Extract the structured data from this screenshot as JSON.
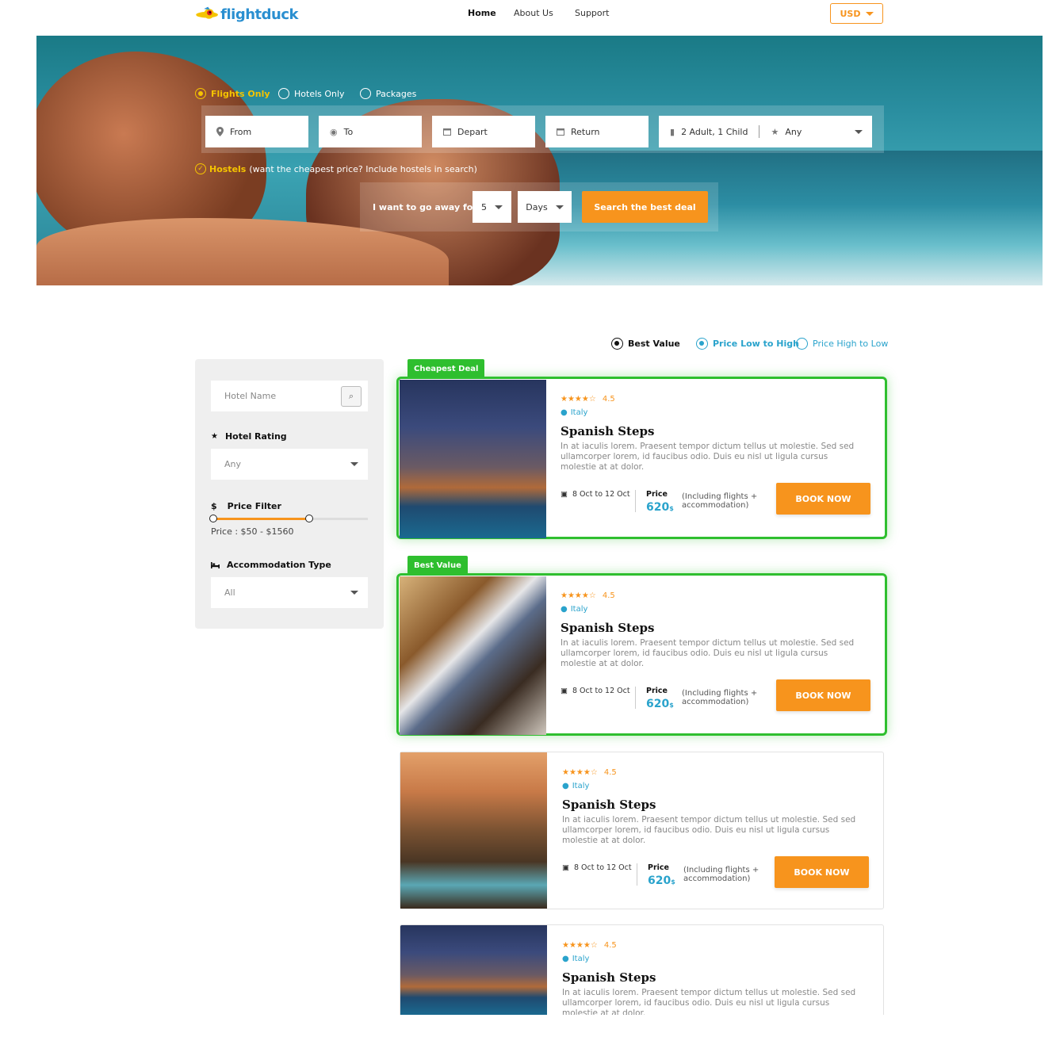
{
  "header": {
    "logo_text": "flightduck",
    "nav": [
      "Home",
      "About Us",
      "Support"
    ],
    "currency": "USD"
  },
  "search": {
    "trip_types": [
      "Flights Only",
      "Hotels Only",
      "Packages"
    ],
    "selected_trip_type": "Flights Only",
    "from": "From",
    "to": "To",
    "depart": "Depart",
    "return": "Return",
    "passengers": "2 Adult, 1 Child",
    "class": "Any",
    "hostels_label": "Hostels",
    "hostels_note": "(want the cheapest price? Include hostels in search)",
    "go_away_label": "I want to go away for",
    "duration_value": "5",
    "duration_unit": "Days",
    "search_button": "Search the best deal"
  },
  "sort": {
    "options": [
      "Best Value",
      "Price Low to High",
      "Price High to Low"
    ]
  },
  "filters": {
    "hotel_name_placeholder": "Hotel Name",
    "rating_label": "Hotel Rating",
    "rating_value": "Any",
    "price_label": "Price Filter",
    "price_symbol": "$",
    "price_range": "Price : $50 - $1560",
    "price_min": 50,
    "price_max": 1560,
    "accommodation_label": "Accommodation Type",
    "accommodation_value": "All"
  },
  "results": [
    {
      "badge": "Cheapest Deal",
      "rating": "4.5",
      "location": "Italy",
      "title": "Spanish Steps",
      "description": "In at iaculis lorem. Praesent tempor dictum tellus ut molestie. Sed sed ullamcorper lorem, id faucibus odio. Duis eu nisl ut ligula cursus molestie at at dolor.",
      "dates": "8 Oct to 12 Oct",
      "price_label": "Price",
      "price": "620",
      "price_currency": "$",
      "price_note": "(Including flights + accommodation)",
      "button": "BOOK NOW"
    },
    {
      "badge": "Best Value",
      "rating": "4.5",
      "location": "Italy",
      "title": "Spanish Steps",
      "description": "In at iaculis lorem. Praesent tempor dictum tellus ut molestie. Sed sed ullamcorper lorem, id faucibus odio. Duis eu nisl ut ligula cursus molestie at at dolor.",
      "dates": "8 Oct to 12 Oct",
      "price_label": "Price",
      "price": "620",
      "price_currency": "$",
      "price_note": "(Including flights + accommodation)",
      "button": "BOOK NOW"
    },
    {
      "rating": "4.5",
      "location": "Italy",
      "title": "Spanish Steps",
      "description": "In at iaculis lorem. Praesent tempor dictum tellus ut molestie. Sed sed ullamcorper lorem, id faucibus odio. Duis eu nisl ut ligula cursus molestie at at dolor.",
      "dates": "8 Oct to 12 Oct",
      "price_label": "Price",
      "price": "620",
      "price_currency": "$",
      "price_note": "(Including flights + accommodation)",
      "button": "BOOK NOW"
    },
    {
      "rating": "4.5",
      "location": "Italy",
      "title": "Spanish Steps",
      "description": "In at iaculis lorem. Praesent tempor dictum tellus ut molestie. Sed sed ullamcorper lorem, id faucibus odio. Duis eu nisl ut ligula cursus molestie at at dolor."
    }
  ],
  "colors": {
    "accent": "#f7941d",
    "highlight": "#2fbf2f",
    "link": "#2aa3cc",
    "selected_trip": "#f5c400"
  }
}
